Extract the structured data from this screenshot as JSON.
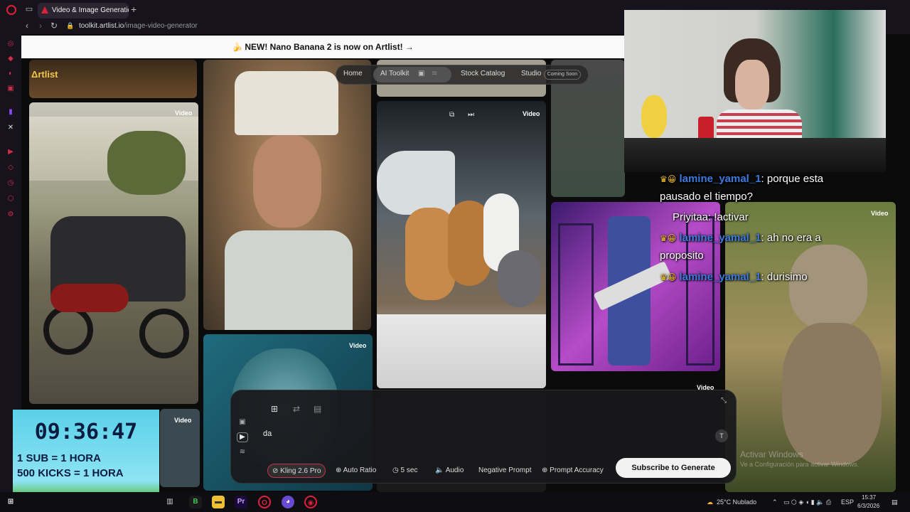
{
  "browser": {
    "tab_title": "Video & Image Generation",
    "new_tab": "+",
    "url_host": "toolkit.artlist.io",
    "url_path": "/image-video-generator"
  },
  "banner": {
    "text": "🍌 NEW! Nano Banana 2 is now on Artlist! →"
  },
  "site": {
    "logo": "Δrtlist",
    "nav": {
      "home": "Home",
      "ai_toolkit": "AI Toolkit",
      "stock_catalog": "Stock Catalog",
      "studio": "Studio",
      "coming_soon": "Coming Soon"
    }
  },
  "gallery": {
    "badge": "Video"
  },
  "chat": [
    {
      "user": "lamine_yamal_1",
      "message": ": porque esta"
    },
    {
      "user": "",
      "message": "pausado el tiempo?"
    },
    {
      "user": "Priyitaa",
      "message": ": !activar"
    },
    {
      "user": "lamine_yamal_1",
      "message": ": ah no era a"
    },
    {
      "user": "",
      "message": "proposito"
    },
    {
      "user": "lamine_yamal_1",
      "message": ": durisimo"
    }
  ],
  "timer": {
    "time": "09:36:47",
    "line1": "1 SUB = 1 HORA",
    "line2": "500 KICKS = 1 HORA"
  },
  "generator": {
    "prompt_value": "da",
    "model": "Kling 2.6 Pro",
    "ratio": "Auto Ratio",
    "duration": "5 sec",
    "audio": "Audio",
    "negative_prompt": "Negative Prompt",
    "prompt_accuracy": "Prompt Accuracy",
    "subscribe": "Subscribe to Generate"
  },
  "watermark": {
    "title": "Activar Windows",
    "subtitle": "Ve a Configuración para activar Windows."
  },
  "taskbar": {
    "weather": "25°C  Nublado",
    "lang": "ESP",
    "time": "15:37",
    "date": "6/3/2026"
  },
  "colors": {
    "accent": "#e0203a",
    "brand": "#f3c74b",
    "chat_user": "#3b7bde"
  }
}
